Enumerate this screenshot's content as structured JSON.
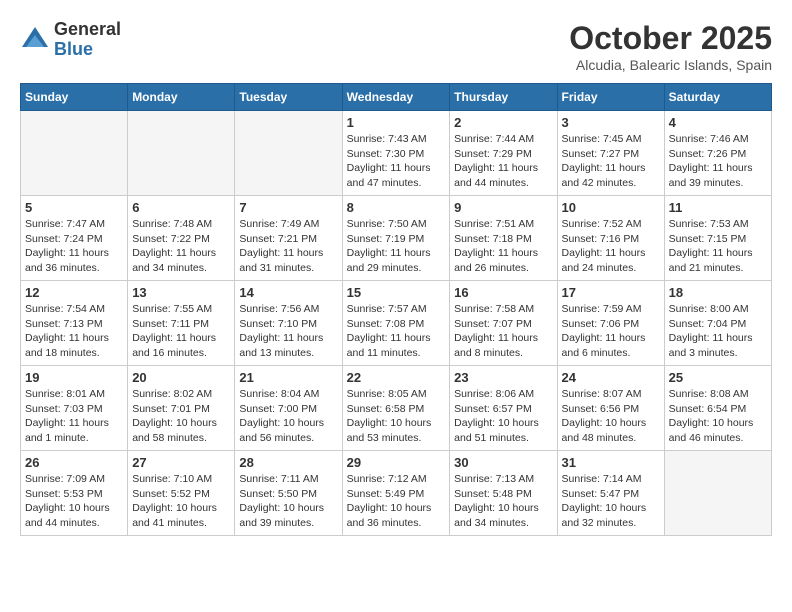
{
  "header": {
    "logo_general": "General",
    "logo_blue": "Blue",
    "month_title": "October 2025",
    "location": "Alcudia, Balearic Islands, Spain"
  },
  "days_of_week": [
    "Sunday",
    "Monday",
    "Tuesday",
    "Wednesday",
    "Thursday",
    "Friday",
    "Saturday"
  ],
  "weeks": [
    [
      {
        "day": "",
        "info": ""
      },
      {
        "day": "",
        "info": ""
      },
      {
        "day": "",
        "info": ""
      },
      {
        "day": "1",
        "info": "Sunrise: 7:43 AM\nSunset: 7:30 PM\nDaylight: 11 hours and 47 minutes."
      },
      {
        "day": "2",
        "info": "Sunrise: 7:44 AM\nSunset: 7:29 PM\nDaylight: 11 hours and 44 minutes."
      },
      {
        "day": "3",
        "info": "Sunrise: 7:45 AM\nSunset: 7:27 PM\nDaylight: 11 hours and 42 minutes."
      },
      {
        "day": "4",
        "info": "Sunrise: 7:46 AM\nSunset: 7:26 PM\nDaylight: 11 hours and 39 minutes."
      }
    ],
    [
      {
        "day": "5",
        "info": "Sunrise: 7:47 AM\nSunset: 7:24 PM\nDaylight: 11 hours and 36 minutes."
      },
      {
        "day": "6",
        "info": "Sunrise: 7:48 AM\nSunset: 7:22 PM\nDaylight: 11 hours and 34 minutes."
      },
      {
        "day": "7",
        "info": "Sunrise: 7:49 AM\nSunset: 7:21 PM\nDaylight: 11 hours and 31 minutes."
      },
      {
        "day": "8",
        "info": "Sunrise: 7:50 AM\nSunset: 7:19 PM\nDaylight: 11 hours and 29 minutes."
      },
      {
        "day": "9",
        "info": "Sunrise: 7:51 AM\nSunset: 7:18 PM\nDaylight: 11 hours and 26 minutes."
      },
      {
        "day": "10",
        "info": "Sunrise: 7:52 AM\nSunset: 7:16 PM\nDaylight: 11 hours and 24 minutes."
      },
      {
        "day": "11",
        "info": "Sunrise: 7:53 AM\nSunset: 7:15 PM\nDaylight: 11 hours and 21 minutes."
      }
    ],
    [
      {
        "day": "12",
        "info": "Sunrise: 7:54 AM\nSunset: 7:13 PM\nDaylight: 11 hours and 18 minutes."
      },
      {
        "day": "13",
        "info": "Sunrise: 7:55 AM\nSunset: 7:11 PM\nDaylight: 11 hours and 16 minutes."
      },
      {
        "day": "14",
        "info": "Sunrise: 7:56 AM\nSunset: 7:10 PM\nDaylight: 11 hours and 13 minutes."
      },
      {
        "day": "15",
        "info": "Sunrise: 7:57 AM\nSunset: 7:08 PM\nDaylight: 11 hours and 11 minutes."
      },
      {
        "day": "16",
        "info": "Sunrise: 7:58 AM\nSunset: 7:07 PM\nDaylight: 11 hours and 8 minutes."
      },
      {
        "day": "17",
        "info": "Sunrise: 7:59 AM\nSunset: 7:06 PM\nDaylight: 11 hours and 6 minutes."
      },
      {
        "day": "18",
        "info": "Sunrise: 8:00 AM\nSunset: 7:04 PM\nDaylight: 11 hours and 3 minutes."
      }
    ],
    [
      {
        "day": "19",
        "info": "Sunrise: 8:01 AM\nSunset: 7:03 PM\nDaylight: 11 hours and 1 minute."
      },
      {
        "day": "20",
        "info": "Sunrise: 8:02 AM\nSunset: 7:01 PM\nDaylight: 10 hours and 58 minutes."
      },
      {
        "day": "21",
        "info": "Sunrise: 8:04 AM\nSunset: 7:00 PM\nDaylight: 10 hours and 56 minutes."
      },
      {
        "day": "22",
        "info": "Sunrise: 8:05 AM\nSunset: 6:58 PM\nDaylight: 10 hours and 53 minutes."
      },
      {
        "day": "23",
        "info": "Sunrise: 8:06 AM\nSunset: 6:57 PM\nDaylight: 10 hours and 51 minutes."
      },
      {
        "day": "24",
        "info": "Sunrise: 8:07 AM\nSunset: 6:56 PM\nDaylight: 10 hours and 48 minutes."
      },
      {
        "day": "25",
        "info": "Sunrise: 8:08 AM\nSunset: 6:54 PM\nDaylight: 10 hours and 46 minutes."
      }
    ],
    [
      {
        "day": "26",
        "info": "Sunrise: 7:09 AM\nSunset: 5:53 PM\nDaylight: 10 hours and 44 minutes."
      },
      {
        "day": "27",
        "info": "Sunrise: 7:10 AM\nSunset: 5:52 PM\nDaylight: 10 hours and 41 minutes."
      },
      {
        "day": "28",
        "info": "Sunrise: 7:11 AM\nSunset: 5:50 PM\nDaylight: 10 hours and 39 minutes."
      },
      {
        "day": "29",
        "info": "Sunrise: 7:12 AM\nSunset: 5:49 PM\nDaylight: 10 hours and 36 minutes."
      },
      {
        "day": "30",
        "info": "Sunrise: 7:13 AM\nSunset: 5:48 PM\nDaylight: 10 hours and 34 minutes."
      },
      {
        "day": "31",
        "info": "Sunrise: 7:14 AM\nSunset: 5:47 PM\nDaylight: 10 hours and 32 minutes."
      },
      {
        "day": "",
        "info": ""
      }
    ]
  ]
}
